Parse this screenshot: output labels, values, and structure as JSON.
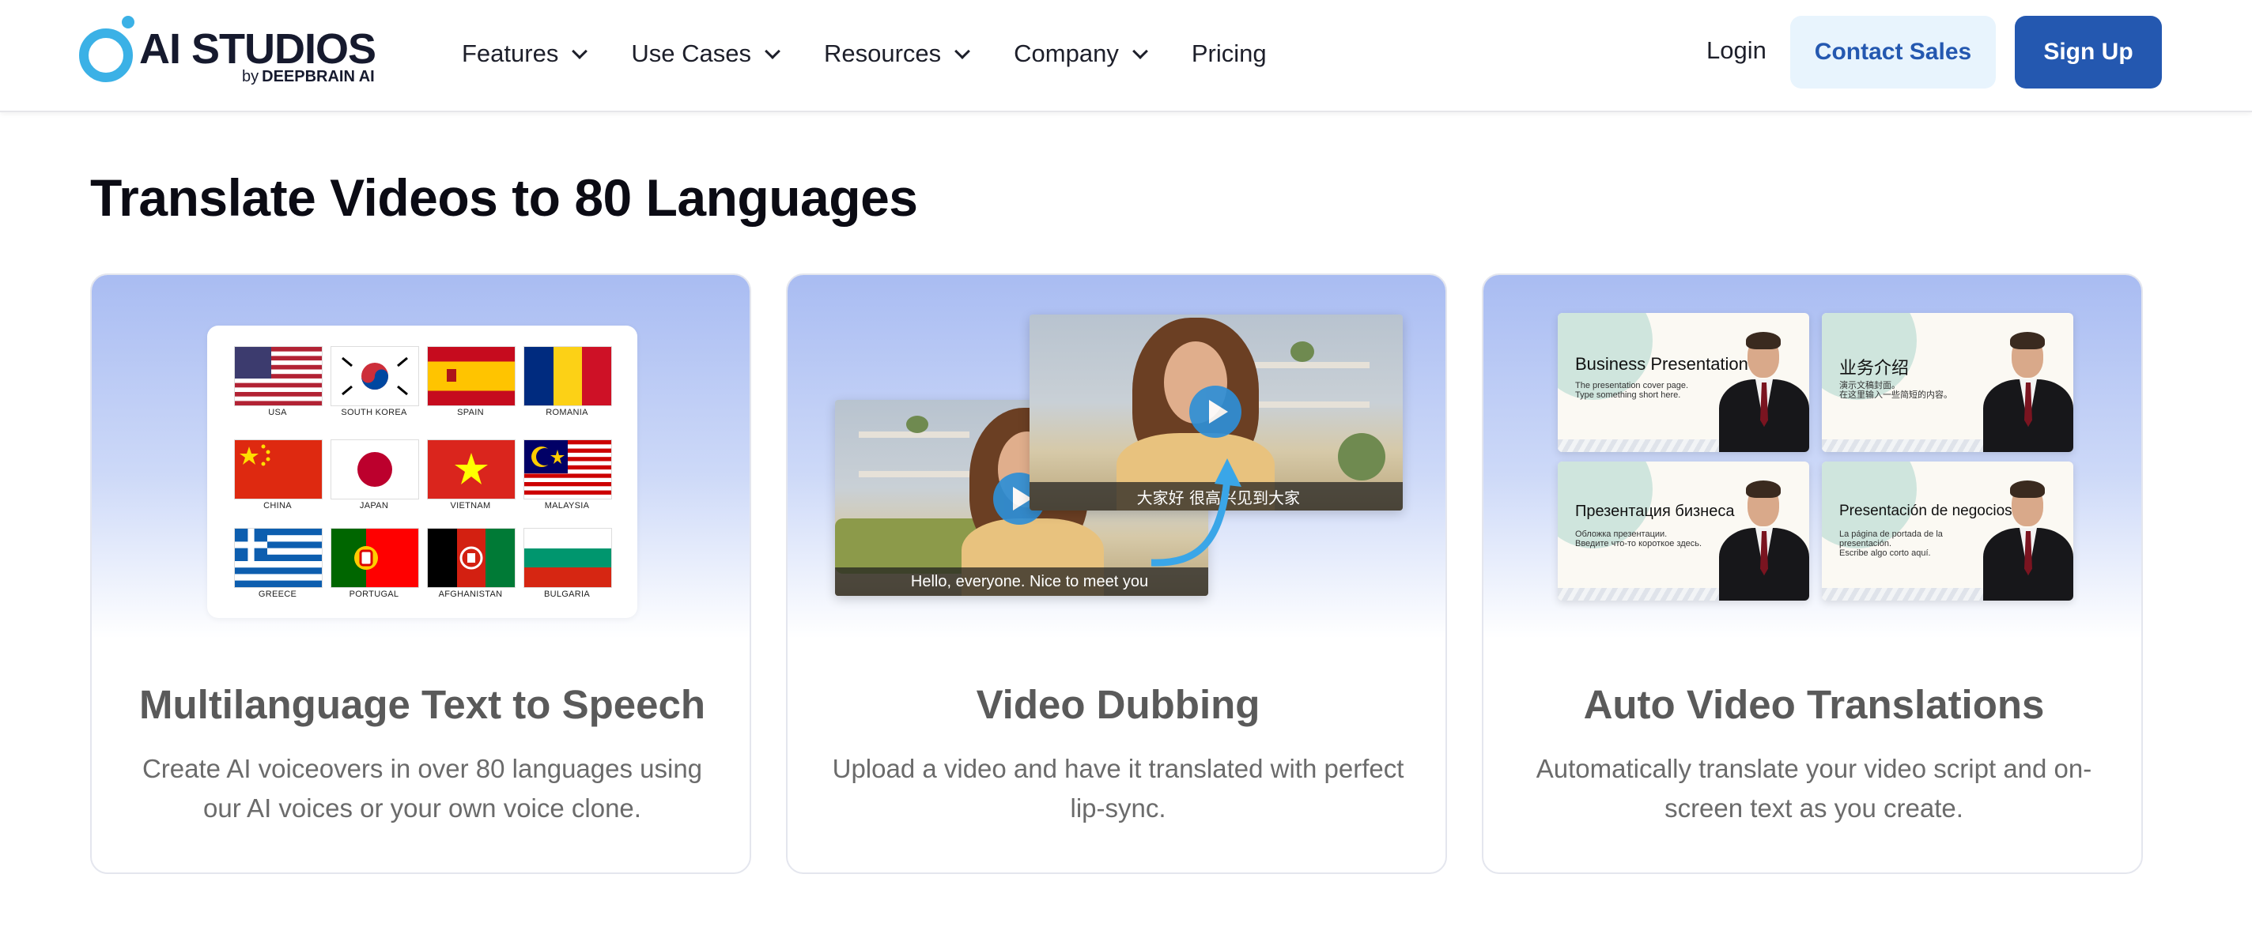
{
  "brand": {
    "name": "AI STUDIOS",
    "sub_by": "by",
    "sub_company": "DEEPBRAIN AI",
    "accent_color": "#3bb1e6"
  },
  "nav": {
    "items": [
      {
        "label": "Features",
        "has_dropdown": true
      },
      {
        "label": "Use Cases",
        "has_dropdown": true
      },
      {
        "label": "Resources",
        "has_dropdown": true
      },
      {
        "label": "Company",
        "has_dropdown": true
      },
      {
        "label": "Pricing",
        "has_dropdown": false
      }
    ],
    "login": "Login",
    "contact_sales": "Contact Sales",
    "sign_up": "Sign Up",
    "primary_color": "#2458b0"
  },
  "section": {
    "title": "Translate Videos to 80 Languages"
  },
  "cards": [
    {
      "title": "Multilanguage Text to Speech",
      "description": "Create AI voiceovers in over 80 languages using our AI voices or your own voice clone.",
      "flags": [
        "USA",
        "SOUTH KOREA",
        "SPAIN",
        "ROMANIA",
        "CHINA",
        "JAPAN",
        "VIETNAM",
        "MALAYSIA",
        "GREECE",
        "PORTUGAL",
        "AFGHANISTAN",
        "BULGARIA"
      ]
    },
    {
      "title": "Video Dubbing",
      "description": "Upload a video and have it translated with perfect lip-sync.",
      "subtitle_front": "Hello, everyone. Nice to meet you",
      "subtitle_back": "大家好 很高兴见到大家"
    },
    {
      "title": "Auto Video Translations",
      "description": "Automatically translate your video script and on-screen text as you create.",
      "slides": [
        {
          "title": "Business Presentation",
          "sub1": "The presentation cover page.",
          "sub2": "Type something short here."
        },
        {
          "title": "业务介绍",
          "sub1": "演示文稿封面。",
          "sub2": "在这里输入一些简短的内容。"
        },
        {
          "title": "Презентация бизнеса",
          "sub1": "Обложка презентации.",
          "sub2": "Введите что-то короткое здесь."
        },
        {
          "title": "Presentación de negocios",
          "sub1": "La página de portada de la presentación.",
          "sub2": "Escribe algo corto aquí."
        }
      ]
    }
  ]
}
